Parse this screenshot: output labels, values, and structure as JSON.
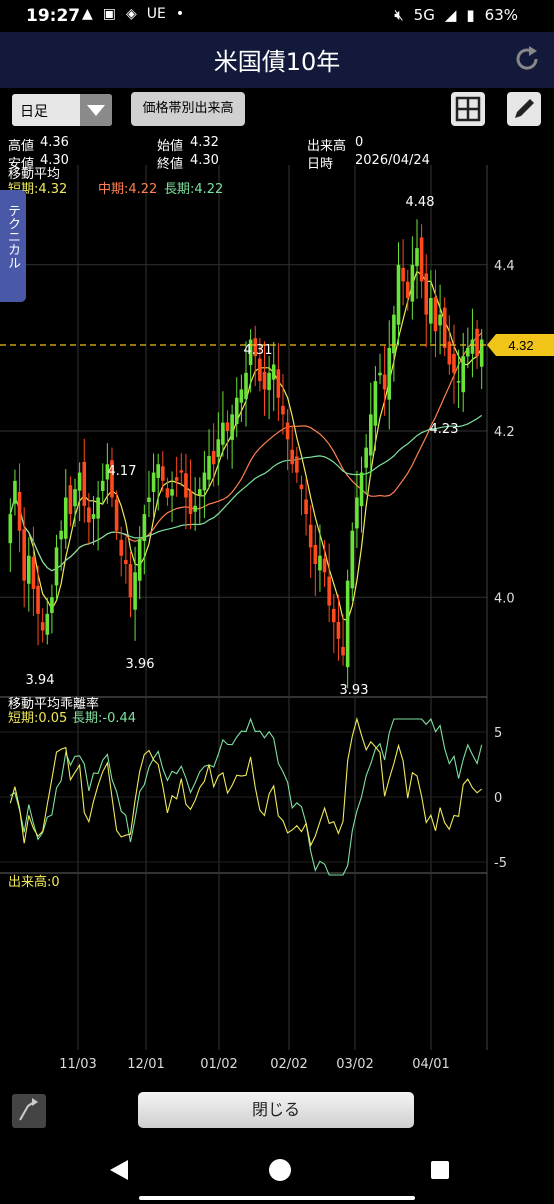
{
  "status_bar": {
    "time": "19:27",
    "carrier_label": "UE",
    "network": "5G",
    "battery": "63%"
  },
  "header": {
    "title": "米国債10年"
  },
  "toolbar": {
    "period_select": "日足",
    "volume_button": "価格帯別出来高"
  },
  "ohlc": {
    "high_label": "高値",
    "high_value": "4.36",
    "open_label": "始値",
    "open_value": "4.32",
    "volume_label": "出来高",
    "volume_value": "0",
    "low_label": "安値",
    "low_value": "4.30",
    "close_label": "終値",
    "close_value": "4.30",
    "date_label": "日時",
    "date_value": "2026/04/24"
  },
  "side_tab": {
    "label": "テクニカル"
  },
  "ma_panel": {
    "title": "移動平均",
    "short": "短期:4.32",
    "mid": "中期:4.22",
    "long": "長期:4.22"
  },
  "dev_panel": {
    "title": "移動平均乖離率",
    "short": "短期:0.05",
    "long": "長期:-0.44"
  },
  "vol_panel": {
    "label": "出来高:0"
  },
  "colors": {
    "up": "#69e33a",
    "down": "#ff4a1e",
    "short_ma": "#f0ea5a",
    "mid_ma": "#ff8050",
    "long_ma": "#7fe0a0",
    "price_tag": "#f0c419"
  },
  "chart_data": {
    "type": "candlestick",
    "price_axis_ticks": [
      "4.4",
      "4.2",
      "4.0"
    ],
    "ylim": [
      3.88,
      4.52
    ],
    "x_ticks": [
      "11/03",
      "12/01",
      "01/02",
      "02/02",
      "03/02",
      "04/01"
    ],
    "current_price": "4.32",
    "annotations": [
      {
        "label": "4.48",
        "value": 4.48
      },
      {
        "label": "4.31",
        "value": 4.31
      },
      {
        "label": "4.17",
        "value": 4.17
      },
      {
        "label": "4.23",
        "value": 4.23
      },
      {
        "label": "3.94",
        "value": 3.94
      },
      {
        "label": "3.96",
        "value": 3.96
      },
      {
        "label": "3.93",
        "value": 3.93
      }
    ],
    "closes": [
      4.1,
      4.14,
      4.08,
      4.02,
      4.05,
      4.01,
      3.98,
      3.96,
      3.98,
      4.0,
      4.06,
      4.08,
      4.12,
      4.1,
      4.13,
      4.15,
      4.11,
      4.09,
      4.1,
      4.12,
      4.14,
      4.16,
      4.12,
      4.08,
      4.05,
      4.04,
      4.0,
      4.03,
      4.07,
      4.1,
      4.12,
      4.15,
      4.16,
      4.14,
      4.12,
      4.13,
      4.14,
      4.15,
      4.12,
      4.1,
      4.11,
      4.13,
      4.15,
      4.17,
      4.16,
      4.19,
      4.21,
      4.2,
      4.22,
      4.24,
      4.25,
      4.27,
      4.31,
      4.29,
      4.26,
      4.25,
      4.27,
      4.28,
      4.24,
      4.22,
      4.19,
      4.16,
      4.15,
      4.13,
      4.1,
      4.06,
      4.04,
      4.05,
      4.03,
      3.99,
      3.97,
      3.95,
      3.93,
      4.02,
      4.08,
      4.12,
      4.15,
      4.18,
      4.22,
      4.26,
      4.27,
      4.25,
      4.3,
      4.34,
      4.4,
      4.38,
      4.36,
      4.4,
      4.42,
      4.38,
      4.34,
      4.36,
      4.32,
      4.34,
      4.3,
      4.28,
      4.27,
      4.26,
      4.29,
      4.3,
      4.31,
      4.29,
      4.31
    ],
    "deviation_yaxis": [
      "5",
      "0",
      "-5"
    ],
    "deviation_short_last": 0.05,
    "deviation_long_last": -0.44
  }
}
